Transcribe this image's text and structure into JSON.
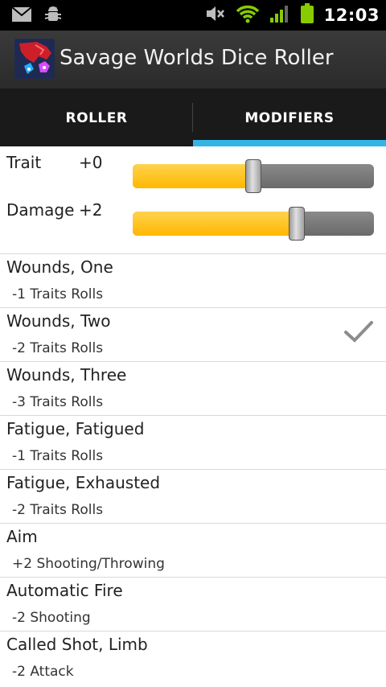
{
  "status_bar": {
    "time": "12:03",
    "icons": [
      "mail-icon",
      "android-debug-icon",
      "mute-icon",
      "wifi-icon",
      "signal-icon",
      "battery-icon"
    ],
    "battery_color": "#88cc00",
    "wifi_color": "#88cc00"
  },
  "app_bar": {
    "title": "Savage Worlds Dice Roller"
  },
  "tabs": [
    {
      "label": "ROLLER",
      "selected": false
    },
    {
      "label": "MODIFIERS",
      "selected": true
    }
  ],
  "accent_color": "#33b5e5",
  "sliders": [
    {
      "label": "Trait",
      "value_text": "+0",
      "level": 0.5
    },
    {
      "label": "Damage",
      "value_text": "+2",
      "level": 0.68
    }
  ],
  "modifiers": [
    {
      "title": "Wounds, One",
      "subtitle": "-1 Traits Rolls",
      "checked": false
    },
    {
      "title": "Wounds, Two",
      "subtitle": "-2 Traits Rolls",
      "checked": true
    },
    {
      "title": "Wounds, Three",
      "subtitle": "-3 Traits Rolls",
      "checked": false
    },
    {
      "title": "Fatigue, Fatigued",
      "subtitle": "-1 Traits Rolls",
      "checked": false
    },
    {
      "title": "Fatigue, Exhausted",
      "subtitle": "-2 Traits Rolls",
      "checked": false
    },
    {
      "title": "Aim",
      "subtitle": "+2 Shooting/Throwing",
      "checked": false
    },
    {
      "title": "Automatic Fire",
      "subtitle": "-2 Shooting",
      "checked": false
    },
    {
      "title": "Called Shot, Limb",
      "subtitle": "-2 Attack",
      "checked": false
    }
  ]
}
